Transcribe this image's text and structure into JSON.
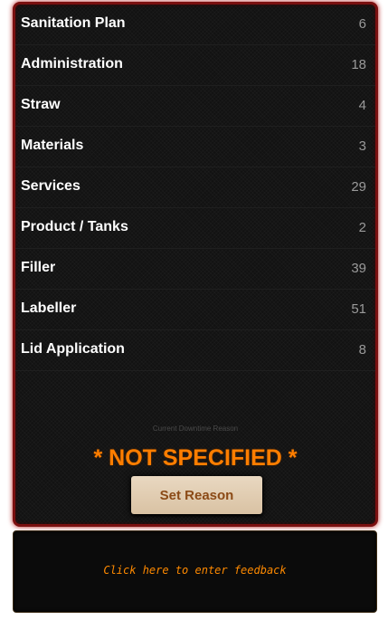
{
  "categories": [
    {
      "label": "Sanitation Plan",
      "count": "6"
    },
    {
      "label": "Administration",
      "count": "18"
    },
    {
      "label": "Straw",
      "count": "4"
    },
    {
      "label": "Materials",
      "count": "3"
    },
    {
      "label": "Services",
      "count": "29"
    },
    {
      "label": "Product / Tanks",
      "count": "2"
    },
    {
      "label": "Filler",
      "count": "39"
    },
    {
      "label": "Labeller",
      "count": "51"
    },
    {
      "label": "Lid Application",
      "count": "8"
    }
  ],
  "downtime": {
    "caption": "Current Downtime Reason",
    "value": "* NOT SPECIFIED *",
    "set_reason_label": "Set Reason"
  },
  "feedback": {
    "prompt": "Click here to enter feedback"
  },
  "colors": {
    "panel_border": "#7a1010",
    "accent_orange": "#ff7e00",
    "button_bg": "#e9d8c1",
    "button_text": "#8b4a16"
  }
}
